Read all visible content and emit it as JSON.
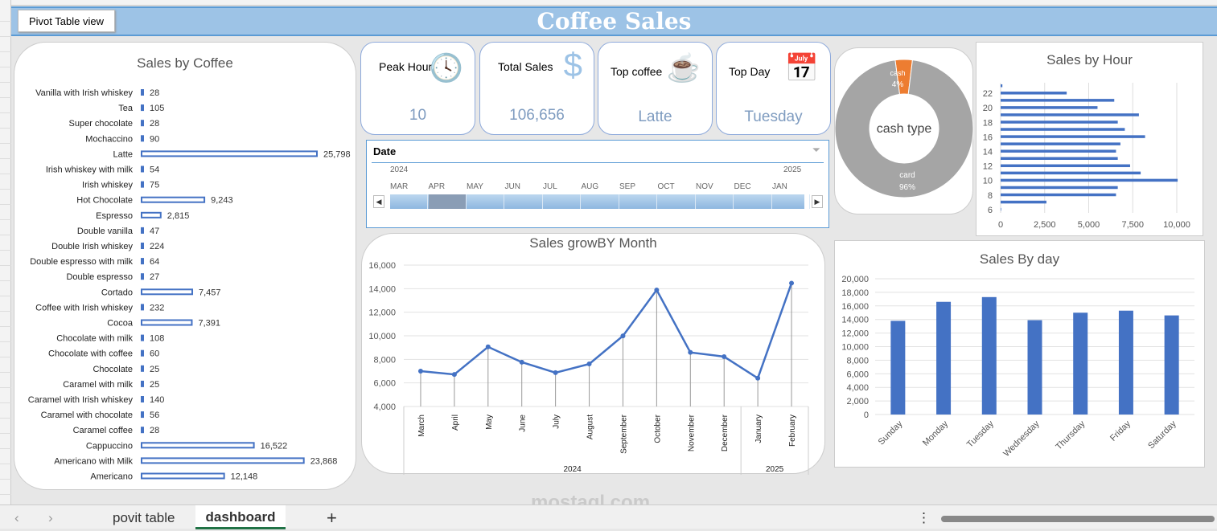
{
  "title": "Coffee Sales",
  "pivot_button": "Pivot Table view",
  "kpis": {
    "peak_hour": {
      "label": "Peak Hour",
      "value": "10"
    },
    "total_sales": {
      "label": "Total Sales",
      "value": "106,656"
    },
    "top_coffee": {
      "label": "Top coffee",
      "value": "Latte"
    },
    "top_day": {
      "label": "Top Day",
      "value": "Tuesday"
    }
  },
  "slicer": {
    "title": "Date",
    "years": [
      "2024",
      "2025"
    ],
    "months": [
      "MAR",
      "APR",
      "MAY",
      "JUN",
      "JUL",
      "AUG",
      "SEP",
      "OCT",
      "NOV",
      "DEC",
      "JAN"
    ],
    "selected": "APR"
  },
  "tabs": [
    "povit table",
    "dashboard"
  ],
  "active_tab": "dashboard",
  "watermark": "mostaql.com",
  "colors": {
    "bar": "#4472c4",
    "cash": "#ed7d31",
    "card": "#a5a5a5",
    "title_bg": "#9dc3e6"
  },
  "chart_data": [
    {
      "type": "bar",
      "title": "Sales by Coffee",
      "categories": [
        "Vanilla with Irish whiskey",
        "Tea",
        "Super chocolate",
        "Mochaccino",
        "Latte",
        "Irish whiskey with milk",
        "Irish whiskey",
        "Hot Chocolate",
        "Espresso",
        "Double vanilla",
        "Double Irish whiskey",
        "Double espresso with milk",
        "Double espresso",
        "Cortado",
        "Coffee with Irish whiskey",
        "Cocoa",
        "Chocolate with milk",
        "Chocolate with coffee",
        "Chocolate",
        "Caramel with milk",
        "Caramel with Irish whiskey",
        "Caramel with chocolate",
        "Caramel coffee",
        "Cappuccino",
        "Americano with Milk",
        "Americano"
      ],
      "values": [
        28,
        105,
        28,
        90,
        25798,
        54,
        75,
        9243,
        2815,
        47,
        224,
        64,
        27,
        7457,
        232,
        7391,
        108,
        60,
        25,
        25,
        140,
        56,
        28,
        16522,
        23868,
        12148
      ],
      "labels": [
        "28",
        "105",
        "28",
        "90",
        "25,798",
        "54",
        "75",
        "9,243",
        "2,815",
        "47",
        "224",
        "64",
        "27",
        "7,457",
        "232",
        "7,391",
        "108",
        "60",
        "25",
        "25",
        "140",
        "56",
        "28",
        "16,522",
        "23,868",
        "12,148"
      ]
    },
    {
      "type": "pie",
      "title": "cash type",
      "slices": [
        {
          "name": "cash",
          "value": 4,
          "label": "4%"
        },
        {
          "name": "card",
          "value": 96,
          "label": "96%"
        }
      ]
    },
    {
      "type": "bar",
      "title": "Sales by Hour",
      "categories": [
        6,
        7,
        8,
        9,
        10,
        11,
        12,
        13,
        14,
        15,
        16,
        17,
        18,
        19,
        20,
        21,
        22,
        23
      ],
      "values": [
        30,
        2600,
        6550,
        6650,
        10050,
        7950,
        7350,
        6650,
        6550,
        6800,
        8200,
        7050,
        6650,
        7850,
        5500,
        6450,
        3750,
        100
      ],
      "xticks": [
        "0",
        "2,500",
        "5,000",
        "7,500",
        "10,000"
      ],
      "xlim": [
        0,
        10000
      ],
      "yticks": [
        "6",
        "8",
        "10",
        "12",
        "14",
        "16",
        "18",
        "20",
        "22"
      ]
    },
    {
      "type": "line",
      "title": "Sales growBY Month",
      "categories": [
        "March",
        "April",
        "May",
        "June",
        "July",
        "August",
        "September",
        "October",
        "November",
        "December",
        "January",
        "February"
      ],
      "years": [
        "2024",
        "2025"
      ],
      "values": [
        7000,
        6720,
        9060,
        7760,
        6870,
        7610,
        9990,
        13890,
        8590,
        8230,
        6400,
        14470
      ],
      "ylim": [
        4000,
        16000
      ],
      "yticks": [
        "4,000",
        "6,000",
        "8,000",
        "10,000",
        "12,000",
        "14,000",
        "16,000"
      ]
    },
    {
      "type": "bar",
      "title": "Sales By day",
      "categories": [
        "Sunday",
        "Monday",
        "Tuesday",
        "Wednesday",
        "Thursday",
        "Friday",
        "Saturday"
      ],
      "values": [
        13800,
        16600,
        17300,
        13900,
        15000,
        15300,
        14600
      ],
      "ylim": [
        0,
        20000
      ],
      "yticks": [
        "0",
        "2,000",
        "4,000",
        "6,000",
        "8,000",
        "10,000",
        "12,000",
        "14,000",
        "16,000",
        "18,000",
        "20,000"
      ]
    }
  ]
}
